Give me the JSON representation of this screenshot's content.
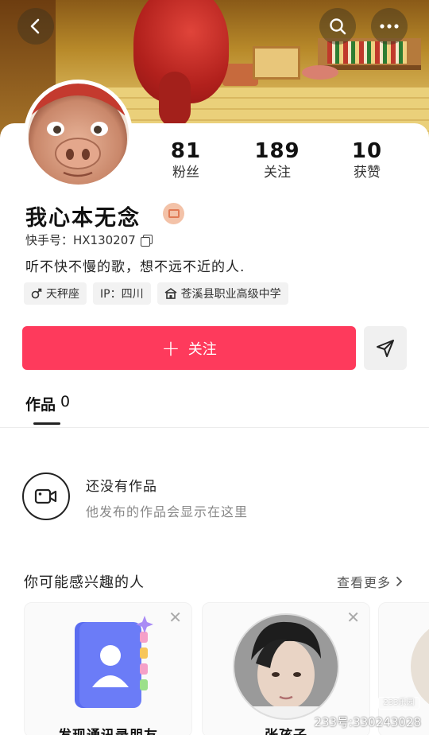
{
  "profile": {
    "nickname": "我心本无念",
    "kuaishou_id": "快手号：HX130207",
    "bio": "听不快不慢的歌，想不远不近的人."
  },
  "stats": [
    {
      "value": "81",
      "label": "粉丝"
    },
    {
      "value": "189",
      "label": "关注"
    },
    {
      "value": "10",
      "label": "获赞"
    }
  ],
  "tags": [
    {
      "icon": "male-icon",
      "text": "天秤座"
    },
    {
      "icon": "",
      "text": "IP：四川"
    },
    {
      "icon": "school-icon",
      "text": "苍溪县职业高级中学"
    }
  ],
  "actions": {
    "follow_label": "关注",
    "follow_color": "#fe3a5c"
  },
  "tabs": [
    {
      "label": "作品",
      "count": "0"
    }
  ],
  "empty_state": {
    "title": "还没有作品",
    "subtitle": "他发布的作品会显示在这里"
  },
  "recommend": {
    "title": "你可能感兴趣的人",
    "more": "查看更多",
    "cards": [
      {
        "name": "发现通讯录朋友"
      },
      {
        "name": "张孩子"
      }
    ]
  },
  "watermark": "233号:330243028",
  "watermark_logo": "233乐园"
}
